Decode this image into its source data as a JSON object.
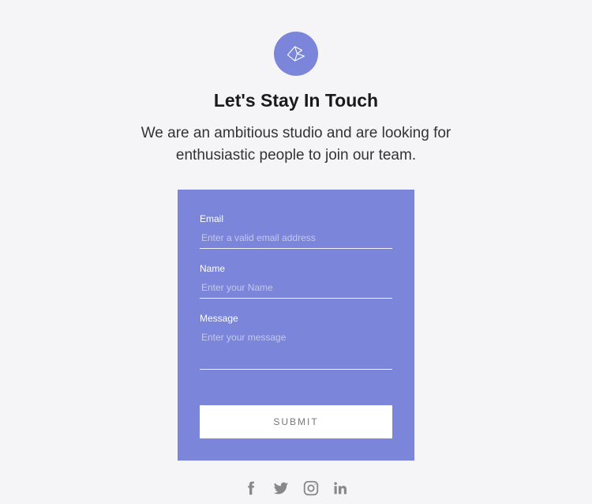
{
  "header": {
    "title": "Let's Stay In Touch",
    "subtitle": "We are an ambitious studio and are looking for enthusiastic people to join our team."
  },
  "form": {
    "email": {
      "label": "Email",
      "placeholder": "Enter a valid email address"
    },
    "name": {
      "label": "Name",
      "placeholder": "Enter your Name"
    },
    "message": {
      "label": "Message",
      "placeholder": "Enter your message"
    },
    "submit": "SUBMIT"
  },
  "social": {
    "facebook": "facebook",
    "twitter": "twitter",
    "instagram": "instagram",
    "linkedin": "linkedin"
  }
}
